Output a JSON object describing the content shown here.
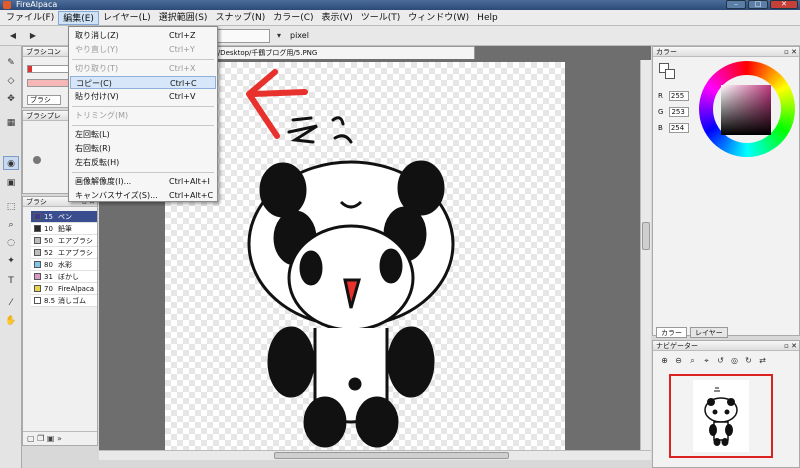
{
  "window": {
    "title": "FireAlpaca",
    "buttons": [
      "–",
      "□",
      "✕"
    ]
  },
  "menubar": [
    "ファイル(F)",
    "編集(E)",
    "レイヤー(L)",
    "選択範囲(S)",
    "スナップ(N)",
    "カラー(C)",
    "表示(V)",
    "ツール(T)",
    "ウィンドウ(W)",
    "Help"
  ],
  "active_menu": "編集(E)",
  "toolbar": {
    "unit": "pixel"
  },
  "document": {
    "tab_path": "vagi/Desktop/千鶴ブログ用/5.PNG"
  },
  "edit_menu": [
    {
      "label": "取り消し(Z)",
      "shortcut": "Ctrl+Z",
      "enabled": true
    },
    {
      "label": "やり直し(Y)",
      "shortcut": "Ctrl+Y",
      "enabled": false
    },
    {
      "separator": true
    },
    {
      "label": "切り取り(T)",
      "shortcut": "Ctrl+X",
      "enabled": false
    },
    {
      "label": "コピー(C)",
      "shortcut": "Ctrl+C",
      "enabled": true,
      "highlighted": true
    },
    {
      "label": "貼り付け(V)",
      "shortcut": "Ctrl+V",
      "enabled": true
    },
    {
      "separator": true
    },
    {
      "label": "トリミング(M)",
      "shortcut": "",
      "enabled": false
    },
    {
      "separator": true
    },
    {
      "label": "左回転(L)",
      "shortcut": "",
      "enabled": true
    },
    {
      "label": "右回転(R)",
      "shortcut": "",
      "enabled": true
    },
    {
      "label": "左右反転(H)",
      "shortcut": "",
      "enabled": true
    },
    {
      "separator": true
    },
    {
      "label": "画像解像度(I)...",
      "shortcut": "Ctrl+Alt+I",
      "enabled": true
    },
    {
      "label": "キャンバスサイズ(S)...",
      "shortcut": "Ctrl+Alt+C",
      "enabled": true
    }
  ],
  "left_panels": {
    "brush_control_title": "ブラシコン",
    "brush_preview_title": "ブラシプレ",
    "brush_shape_label": "ブラシ",
    "brush_list_title": "ブラシ",
    "brushes": [
      {
        "size": "15",
        "name": "ペン",
        "color": "#3a3a8f",
        "selected": true
      },
      {
        "size": "10",
        "name": "鉛筆",
        "color": "#2a2a2a",
        "selected": false
      },
      {
        "size": "50",
        "name": "エアブラシ",
        "color": "#bdbdbd",
        "selected": false
      },
      {
        "size": "52",
        "name": "エアブラシ",
        "color": "#bdbdbd",
        "selected": false
      },
      {
        "size": "80",
        "name": "水彩",
        "color": "#7fc7e8",
        "selected": false
      },
      {
        "size": "31",
        "name": "ぼかし",
        "color": "#d89ac8",
        "selected": false
      },
      {
        "size": "70",
        "name": "FireAlpaca",
        "color": "#e7d64a",
        "selected": false
      },
      {
        "size": "8.5",
        "name": "消しゴム",
        "color": "#ffffff",
        "selected": false
      }
    ]
  },
  "color_panel": {
    "title": "カラー",
    "r": "255",
    "g": "253",
    "b": "254",
    "r_label": "R",
    "g_label": "G",
    "b_label": "B",
    "tabs": [
      "カラー",
      "レイヤー"
    ],
    "hue_color": "#c0397f"
  },
  "navigator": {
    "title": "ナビゲーター"
  },
  "annotation": {
    "arrow_color": "#e8312c"
  },
  "icons": [
    "arrow-left-icon",
    "arrow-right-icon",
    "pen-icon",
    "eraser-icon",
    "fill-icon",
    "select-rect-icon",
    "zoom-in-icon",
    "zoom-out-icon",
    "rotate-icon",
    "text-icon",
    "hand-icon",
    "eyedropper-icon"
  ]
}
